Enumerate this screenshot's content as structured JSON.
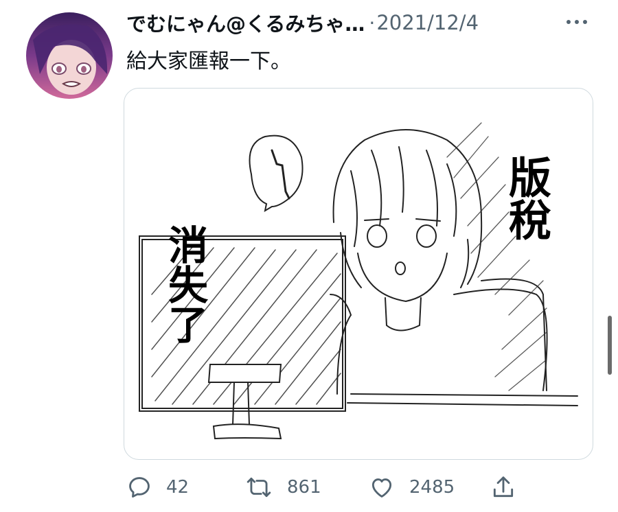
{
  "tweet": {
    "author_name": "でむにゃん@くるみちゃ…",
    "separator": "·",
    "date": "2021/12/4",
    "text": "給大家匯報一下。"
  },
  "media": {
    "right_caption": [
      "版",
      "稅"
    ],
    "left_caption": [
      "消",
      "失",
      "了"
    ]
  },
  "actions": {
    "reply_count": "42",
    "retweet_count": "861",
    "like_count": "2485"
  },
  "icons": {
    "more": "more-horizontal-icon",
    "reply": "reply-icon",
    "retweet": "retweet-icon",
    "like": "heart-icon",
    "share": "share-icon"
  },
  "colors": {
    "text": "#0f1419",
    "secondary": "#536471",
    "border": "#cfd9de"
  }
}
